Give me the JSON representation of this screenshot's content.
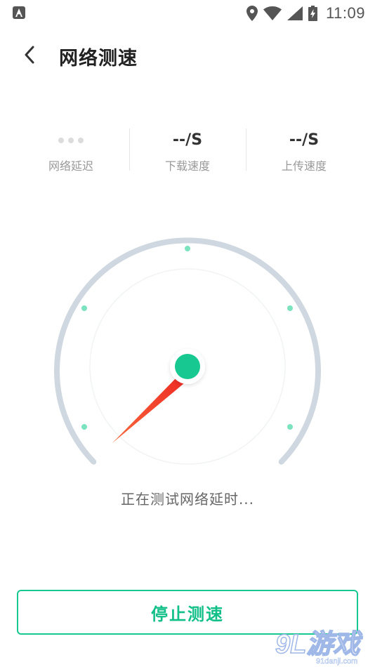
{
  "status_bar": {
    "time": "11:09"
  },
  "header": {
    "title": "网络测速"
  },
  "stats": [
    {
      "key": "latency",
      "value": "",
      "label": "网络延迟"
    },
    {
      "key": "download",
      "value": "--/S",
      "label": "下载速度"
    },
    {
      "key": "upload",
      "value": "--/S",
      "label": "上传速度"
    }
  ],
  "gauge": {
    "status_text": "正在测试网络延时..."
  },
  "actions": {
    "stop_label": "停止测速"
  },
  "watermark": {
    "logo": "9L游戏",
    "url": "91danji.com"
  },
  "colors": {
    "accent": "#17c890",
    "needle": "#f24a2c",
    "track": "#cfd8e0"
  }
}
